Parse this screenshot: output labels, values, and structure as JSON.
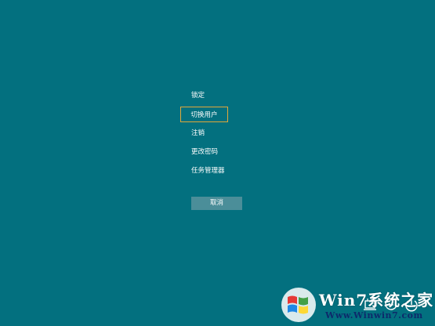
{
  "menu": {
    "items": [
      {
        "label": "锁定",
        "focused": false
      },
      {
        "label": "切换用户",
        "focused": true
      },
      {
        "label": "注销",
        "focused": false
      },
      {
        "label": "更改密码",
        "focused": false
      },
      {
        "label": "任务管理器",
        "focused": false
      }
    ],
    "cancel_label": "取消"
  },
  "tray": {
    "icons": [
      "network-icon",
      "ease-of-access-icon",
      "power-icon"
    ]
  },
  "watermark": {
    "brand": "Win7系统之家",
    "url": "Www.Winwin7.com"
  },
  "colors": {
    "background": "#03707f",
    "focus_border": "#e0a83a",
    "cancel_bg": "#4b8e99"
  }
}
